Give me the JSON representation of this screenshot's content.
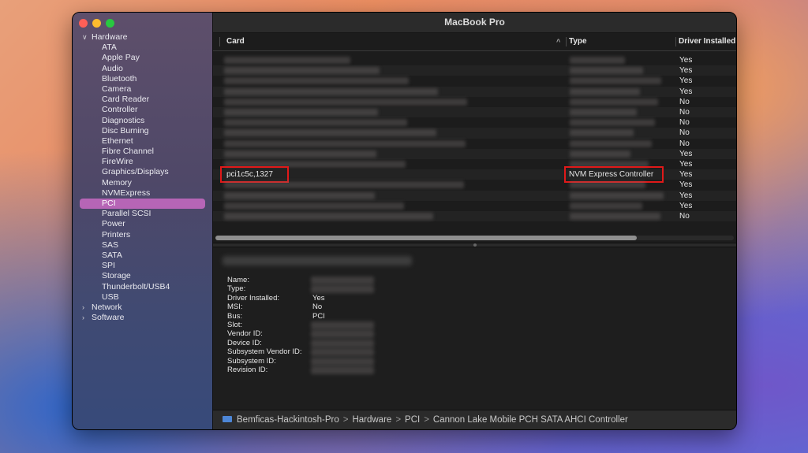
{
  "window": {
    "title": "MacBook Pro"
  },
  "sidebar": {
    "groups": [
      {
        "label": "Hardware",
        "expanded": true,
        "items": [
          "ATA",
          "Apple Pay",
          "Audio",
          "Bluetooth",
          "Camera",
          "Card Reader",
          "Controller",
          "Diagnostics",
          "Disc Burning",
          "Ethernet",
          "Fibre Channel",
          "FireWire",
          "Graphics/Displays",
          "Memory",
          "NVMExpress",
          "PCI",
          "Parallel SCSI",
          "Power",
          "Printers",
          "SAS",
          "SATA",
          "SPI",
          "Storage",
          "Thunderbolt/USB4",
          "USB"
        ],
        "selected": "PCI"
      },
      {
        "label": "Network",
        "expanded": false
      },
      {
        "label": "Software",
        "expanded": false
      }
    ]
  },
  "table": {
    "columns": [
      "Card",
      "Type",
      "Driver Installed"
    ],
    "sort_indicator": "^",
    "rows": [
      {
        "card": "",
        "type": "",
        "driver": "Yes"
      },
      {
        "card": "",
        "type": "",
        "driver": "Yes"
      },
      {
        "card": "",
        "type": "",
        "driver": "Yes"
      },
      {
        "card": "",
        "type": "",
        "driver": "Yes"
      },
      {
        "card": "",
        "type": "",
        "driver": "No"
      },
      {
        "card": "",
        "type": "",
        "driver": "No"
      },
      {
        "card": "",
        "type": "",
        "driver": "No"
      },
      {
        "card": "",
        "type": "",
        "driver": "No"
      },
      {
        "card": "",
        "type": "",
        "driver": "No"
      },
      {
        "card": "",
        "type": "",
        "driver": "Yes"
      },
      {
        "card": "",
        "type": "",
        "driver": "Yes"
      },
      {
        "card": "pci1c5c,1327",
        "type": "NVM Express Controller",
        "driver": "Yes",
        "highlighted": true
      },
      {
        "card": "",
        "type": "",
        "driver": "Yes"
      },
      {
        "card": "",
        "type": "",
        "driver": "Yes"
      },
      {
        "card": "",
        "type": "",
        "driver": "Yes"
      },
      {
        "card": "",
        "type": "",
        "driver": "No"
      }
    ],
    "highlight_color": "#e01919"
  },
  "detail": {
    "fields": [
      {
        "key": "Name:",
        "value": ""
      },
      {
        "key": "Type:",
        "value": ""
      },
      {
        "key": "Driver Installed:",
        "value": "Yes"
      },
      {
        "key": "MSI:",
        "value": "No"
      },
      {
        "key": "Bus:",
        "value": "PCI"
      },
      {
        "key": "Slot:",
        "value": ""
      },
      {
        "key": "Vendor ID:",
        "value": ""
      },
      {
        "key": "Device ID:",
        "value": ""
      },
      {
        "key": "Subsystem Vendor ID:",
        "value": ""
      },
      {
        "key": "Subsystem ID:",
        "value": ""
      },
      {
        "key": "Revision ID:",
        "value": ""
      }
    ]
  },
  "pathbar": {
    "segments": [
      "Bemficas-Hackintosh-Pro",
      "Hardware",
      "PCI",
      "Cannon Lake Mobile PCH SATA AHCI Controller"
    ],
    "separator": ">"
  }
}
